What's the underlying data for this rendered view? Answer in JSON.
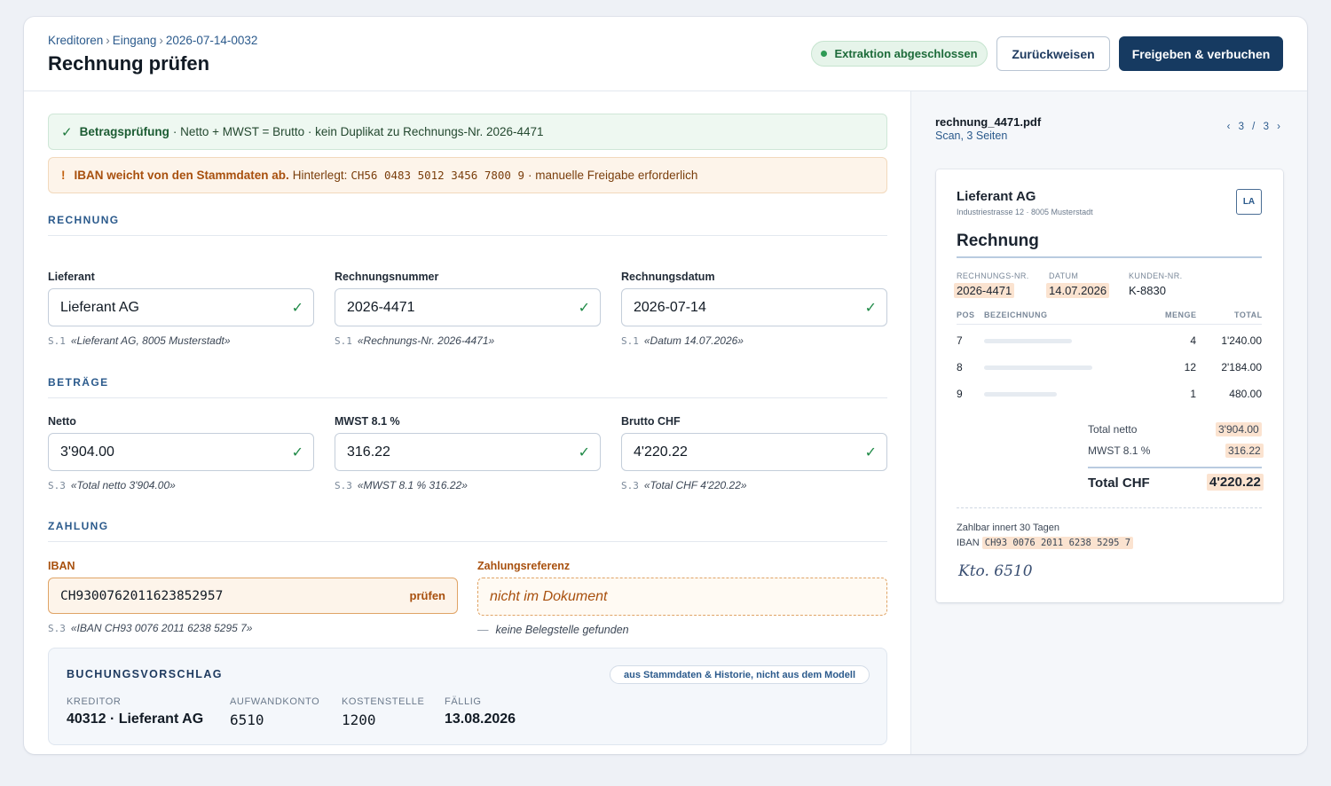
{
  "header": {
    "breadcrumb": [
      "Kreditoren",
      "Eingang",
      "2026-07-14-0032"
    ],
    "breadcrumb_separator": "›",
    "title": "Rechnung prüfen",
    "status": "Extraktion abgeschlossen",
    "reject_label": "Zurückweisen",
    "approve_label": "Freigeben & verbuchen"
  },
  "banners": {
    "ok": {
      "icon": "✓",
      "bold": "Betragsprüfung",
      "text": "· Netto + MWST = Brutto · kein Duplikat zu Rechnungs-Nr. 2026-4471"
    },
    "warn": {
      "icon": "!",
      "bold": "IBAN weicht von den Stammdaten ab.",
      "text_before": "Hinterlegt:",
      "iban": "CH56 0483 5012 3456 7800 9",
      "text_after": "· manuelle Freigabe erforderlich"
    }
  },
  "sections": {
    "invoice": "RECHNUNG",
    "amounts": "BETRÄGE",
    "payment": "ZAHLUNG"
  },
  "fields": {
    "supplier": {
      "label": "Lieferant",
      "value": "Lieferant AG",
      "page": "S.1",
      "source": "«Lieferant AG, 8005 Musterstadt»"
    },
    "invoice_no": {
      "label": "Rechnungsnummer",
      "value": "2026-4471",
      "page": "S.1",
      "source": "«Rechnungs-Nr. 2026-4471»"
    },
    "invoice_date": {
      "label": "Rechnungsdatum",
      "value": "2026-07-14",
      "page": "S.1",
      "source": "«Datum 14.07.2026»"
    },
    "net": {
      "label": "Netto",
      "value": "3'904.00",
      "page": "S.3",
      "source": "«Total netto 3'904.00»"
    },
    "vat": {
      "label": "MWST 8.1 %",
      "value": "316.22",
      "page": "S.3",
      "source": "«MWST 8.1 % 316.22»"
    },
    "gross": {
      "label": "Brutto CHF",
      "value": "4'220.22",
      "page": "S.3",
      "source": "«Total CHF 4'220.22»"
    },
    "iban": {
      "label": "IBAN",
      "value": "CH9300762011623852957",
      "action": "prüfen",
      "page": "S.3",
      "source": "«IBAN CH93 0076 2011 6238 5295 7»"
    },
    "payment_ref": {
      "label": "Zahlungsreferenz",
      "value": "nicht im Dokument",
      "note_dash": "—",
      "note": "keine Belegstelle gefunden"
    }
  },
  "booking": {
    "title": "BUCHUNGSVORSCHLAG",
    "pill": "aus Stammdaten & Historie, nicht aus dem Modell",
    "creditor": {
      "label": "KREDITOR",
      "value": "40312 · Lieferant AG"
    },
    "account": {
      "label": "AUFWANDKONTO",
      "value": "6510"
    },
    "cost_center": {
      "label": "KOSTENSTELLE",
      "value": "1200"
    },
    "due": {
      "label": "FÄLLIG",
      "value": "13.08.2026"
    }
  },
  "preview": {
    "filename": "rechnung_4471.pdf",
    "meta": "Scan, 3 Seiten",
    "pager": "‹ 3 / 3 ›",
    "doc": {
      "vendor": "Lieferant AG",
      "address": "Industriestrasse 12 · 8005 Musterstadt",
      "logo": "LA",
      "title": "Rechnung",
      "meta_labels": [
        "RECHNUNGS-NR.",
        "DATUM",
        "KUNDEN-NR."
      ],
      "meta_values": [
        "2026-4471",
        "14.07.2026",
        "K-8830"
      ],
      "table_headers": [
        "POS",
        "BEZEICHNUNG",
        "MENGE",
        "TOTAL"
      ],
      "rows": [
        {
          "pos": "7",
          "qty": "4",
          "total": "1'240.00"
        },
        {
          "pos": "8",
          "qty": "12",
          "total": "2'184.00"
        },
        {
          "pos": "9",
          "qty": "1",
          "total": "480.00"
        }
      ],
      "sum_net_label": "Total netto",
      "sum_net": "3'904.00",
      "sum_vat_label": "MWST 8.1 %",
      "sum_vat": "316.22",
      "sum_total_label": "Total CHF",
      "sum_total": "4'220.22",
      "pay_terms": "Zahlbar innert 30 Tagen",
      "iban_label": "IBAN",
      "iban": "CH93 0076 2011 6238 5295 7",
      "handwritten": "Kto. 6510"
    }
  },
  "colors": {
    "primary": "#163a61",
    "link": "#2b5a8c",
    "success": "#1f8a47",
    "warning": "#a8500e",
    "highlight": "#fbe3d0"
  }
}
